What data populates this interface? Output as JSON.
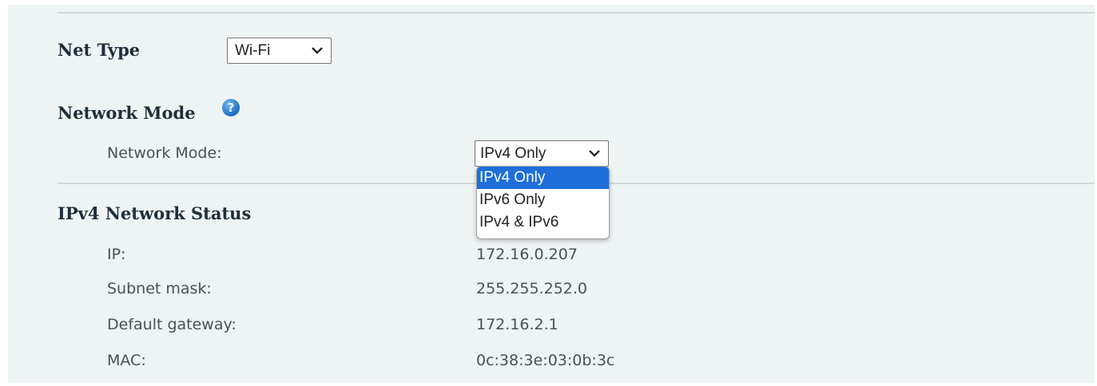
{
  "net_type": {
    "label": "Net Type",
    "value": "Wi-Fi"
  },
  "network_mode": {
    "section_title": "Network Mode",
    "field_label": "Network Mode:",
    "selected": "IPv4 Only",
    "options": [
      "IPv4 Only",
      "IPv6 Only",
      "IPv4 & IPv6"
    ]
  },
  "ipv4_status": {
    "section_title": "IPv4 Network Status",
    "rows": [
      {
        "label": "IP:",
        "value": "172.16.0.207"
      },
      {
        "label": "Subnet mask:",
        "value": "255.255.252.0"
      },
      {
        "label": "Default gateway:",
        "value": "172.16.2.1"
      },
      {
        "label": "MAC:",
        "value": "0c:38:3e:03:0b:3c"
      }
    ]
  },
  "colors": {
    "panel_bg": "#eef3f4",
    "selected_option": "#1e6fd9",
    "help_icon": "#1f6fc2"
  },
  "icons": {
    "help": "question-circle-icon",
    "chevron": "chevron-down-icon"
  }
}
